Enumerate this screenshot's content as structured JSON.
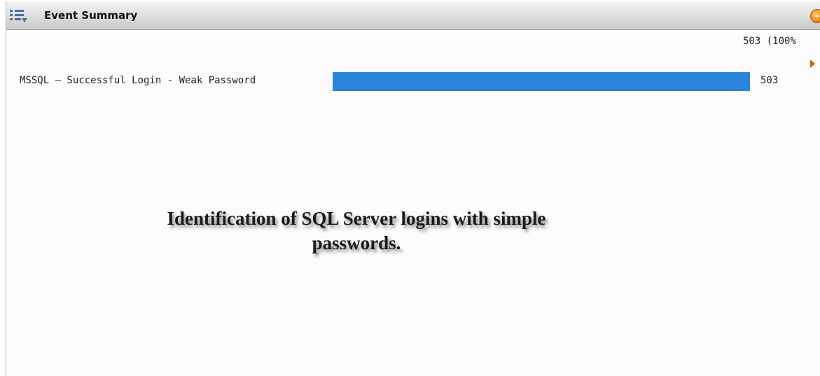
{
  "window": {
    "title": "Event Summary",
    "menu_icon": "list-menu-icon",
    "options_icon": "options-icon"
  },
  "summary": {
    "total_label": "503 (100%"
  },
  "chart_data": {
    "type": "bar",
    "orientation": "horizontal",
    "categories": [
      "MSSQL – Successful Login - Weak Password"
    ],
    "values": [
      503
    ],
    "value_labels": [
      "503"
    ],
    "xlim": [
      0,
      503
    ],
    "bar_color": "#2b84da"
  },
  "annotation": {
    "line1": "Identification of SQL Server logins with simple",
    "line2": "passwords."
  },
  "colors": {
    "bar": "#2b84da",
    "accent": "#f28a10"
  }
}
